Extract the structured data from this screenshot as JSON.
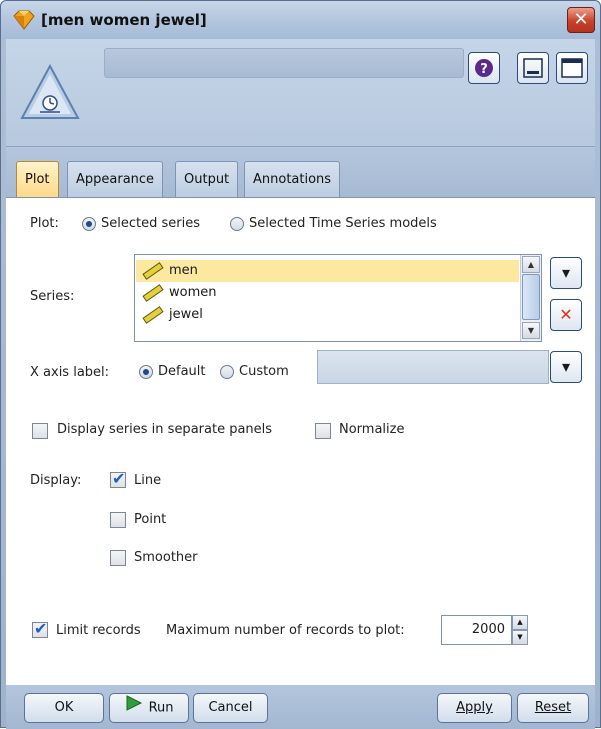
{
  "window": {
    "title": "[men women jewel]"
  },
  "header": {
    "node_name": ""
  },
  "tabs": [
    {
      "label": "Plot",
      "active": true
    },
    {
      "label": "Appearance",
      "active": false
    },
    {
      "label": "Output",
      "active": false
    },
    {
      "label": "Annotations",
      "active": false
    }
  ],
  "plot": {
    "label": "Plot:",
    "options": [
      "Selected series",
      "Selected Time Series models"
    ],
    "selected": "Selected series"
  },
  "series": {
    "label": "Series:",
    "items": [
      "men",
      "women",
      "jewel"
    ],
    "selected": "men"
  },
  "x_axis": {
    "label": "X axis label:",
    "options": [
      "Default",
      "Custom"
    ],
    "selected": "Default",
    "custom_value": ""
  },
  "options": {
    "separate_panels": {
      "label": "Display series in separate panels",
      "checked": false
    },
    "normalize": {
      "label": "Normalize",
      "checked": false
    }
  },
  "display": {
    "label": "Display:",
    "items": [
      {
        "label": "Line",
        "checked": true
      },
      {
        "label": "Point",
        "checked": false
      },
      {
        "label": "Smoother",
        "checked": false
      }
    ]
  },
  "limit": {
    "label": "Limit records",
    "checked": true,
    "max_label": "Maximum number of records to plot:",
    "value": "2000"
  },
  "footer": {
    "ok": "OK",
    "run": "Run",
    "cancel": "Cancel",
    "apply": "Apply",
    "reset": "Reset"
  },
  "icons": {
    "title": "node-diamond-icon",
    "help": "help-icon",
    "minimize": "minimize-icon",
    "maximize": "maximize-icon",
    "field_picker": "field-picker-icon",
    "delete": "delete-x-icon",
    "series_field": "ruler-icon",
    "run": "play-icon"
  },
  "colors": {
    "accent": "#1d4a8c",
    "selection": "#fde8a0",
    "delete": "#d9341c"
  }
}
